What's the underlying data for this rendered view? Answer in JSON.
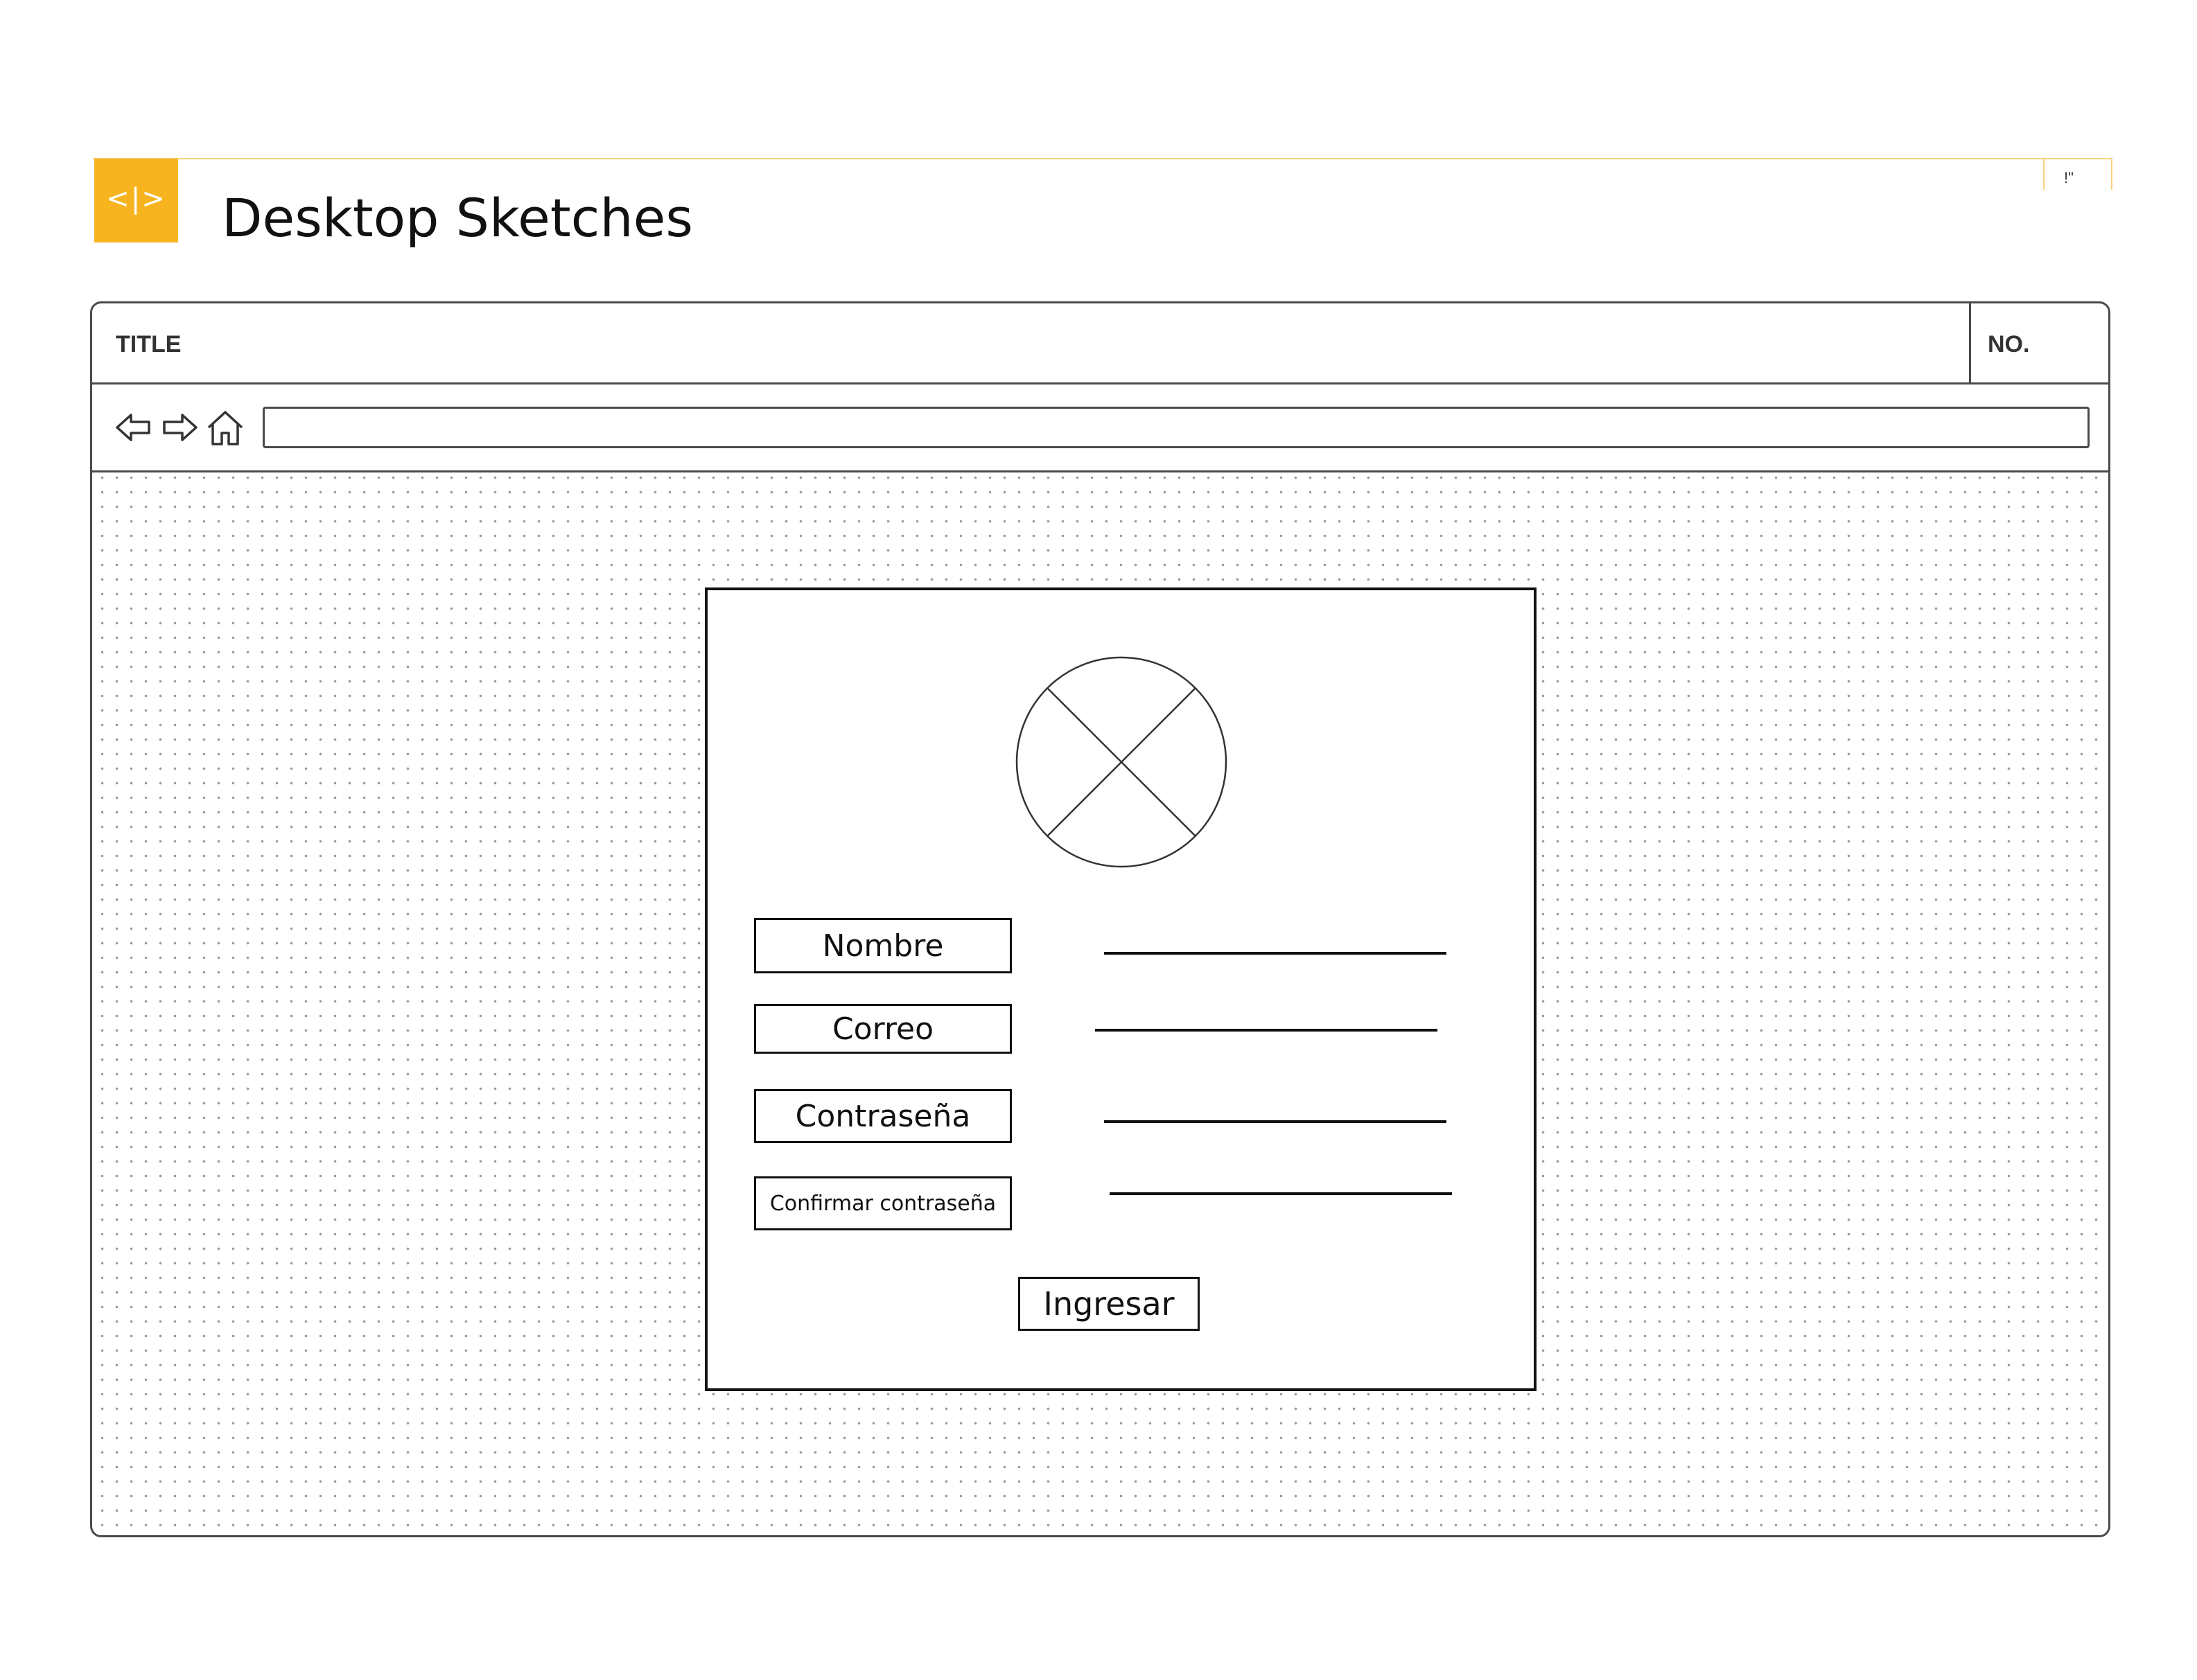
{
  "header": {
    "logo_icon": "code-brackets-icon",
    "logo_glyph": "<|>",
    "title": "Desktop Sketches",
    "corner_mark": "!\"",
    "accent_color": "#f7b41f"
  },
  "browser": {
    "title_label": "TITLE",
    "no_label": "NO.",
    "nav": {
      "back_icon": "back-arrow-icon",
      "forward_icon": "forward-arrow-icon",
      "home_icon": "home-icon"
    },
    "address_bar_value": ""
  },
  "form": {
    "image_placeholder_icon": "image-placeholder-icon",
    "fields": [
      {
        "label": "Nombre",
        "value": ""
      },
      {
        "label": "Correo",
        "value": ""
      },
      {
        "label": "Contraseña",
        "value": ""
      },
      {
        "label": "Confirmar contraseña",
        "value": ""
      }
    ],
    "submit_label": "Ingresar"
  }
}
